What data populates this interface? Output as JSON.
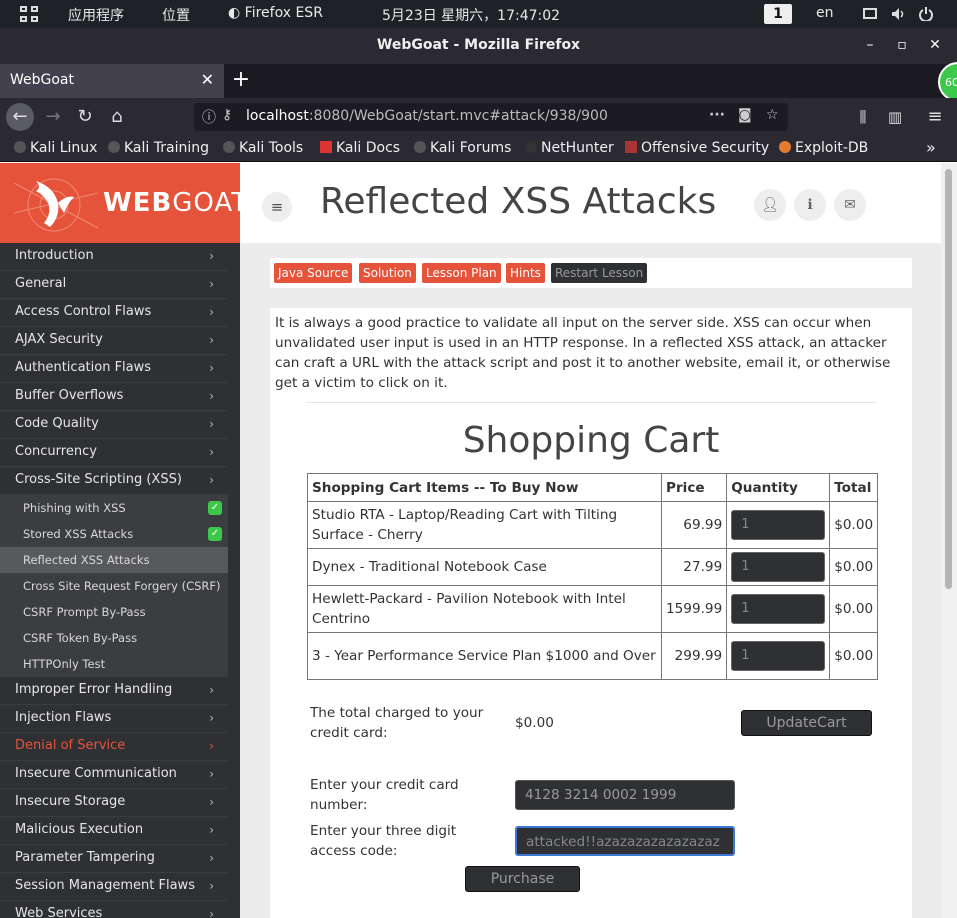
{
  "os": {
    "apps_label": "应用程序",
    "places_label": "位置",
    "active_app": "Firefox ESR",
    "clock": "5月23日 星期六，17:47:02",
    "workspace": "1",
    "lang": "en"
  },
  "window": {
    "title": "WebGoat - Mozilla Firefox"
  },
  "tab": {
    "label": "WebGoat",
    "badge": "60"
  },
  "url": {
    "host": "localhost",
    "rest": ":8080/WebGoat/start.mvc#attack/938/900"
  },
  "bookmarks": [
    "Kali Linux",
    "Kali Training",
    "Kali Tools",
    "Kali Docs",
    "Kali Forums",
    "NetHunter",
    "Offensive Security",
    "Exploit-DB"
  ],
  "logo": {
    "bold": "WEB",
    "light": "GOAT"
  },
  "menu": {
    "introduction": "Introduction",
    "general": "General",
    "access_control": "Access Control Flaws",
    "ajax": "AJAX Security",
    "authentication": "Authentication Flaws",
    "buffer": "Buffer Overflows",
    "code_quality": "Code Quality",
    "concurrency": "Concurrency",
    "xss": "Cross-Site Scripting (XSS)",
    "sub_phishing": "Phishing with XSS",
    "sub_stored": "Stored XSS Attacks",
    "sub_reflected": "Reflected XSS Attacks",
    "sub_csrf": "Cross Site Request Forgery (CSRF)",
    "sub_csrf_prompt": "CSRF Prompt By-Pass",
    "sub_csrf_token": "CSRF Token By-Pass",
    "sub_httponly": "HTTPOnly Test",
    "error_handling": "Improper Error Handling",
    "injection": "Injection Flaws",
    "dos": "Denial of Service",
    "insecure_comm": "Insecure Communication",
    "insecure_storage": "Insecure Storage",
    "malicious": "Malicious Execution",
    "param_tampering": "Parameter Tampering",
    "session": "Session Management Flaws",
    "web_services": "Web Services"
  },
  "header": {
    "title": "Reflected XSS Attacks"
  },
  "lesson_buttons": {
    "java_source": "Java Source",
    "solution": "Solution",
    "lesson_plan": "Lesson Plan",
    "hints": "Hints",
    "restart": "Restart Lesson"
  },
  "intro": "It is always a good practice to validate all input on the server side. XSS can occur when unvalidated user input is used in an HTTP response. In a reflected XSS attack, an attacker can craft a URL with the attack script and post it to another website, email it, or otherwise get a victim to click on it.",
  "cart": {
    "title": "Shopping Cart",
    "headers": [
      "Shopping Cart Items -- To Buy Now",
      "Price",
      "Quantity",
      "Total"
    ],
    "rows": [
      {
        "item": "Studio RTA - Laptop/Reading Cart with Tilting Surface - Cherry",
        "price": "69.99",
        "qty": "1",
        "total": "$0.00"
      },
      {
        "item": "Dynex - Traditional Notebook Case",
        "price": "27.99",
        "qty": "1",
        "total": "$0.00"
      },
      {
        "item": "Hewlett-Packard - Pavilion Notebook with Intel Centrino",
        "price": "1599.99",
        "qty": "1",
        "total": "$0.00"
      },
      {
        "item": "3 - Year Performance Service Plan $1000 and Over",
        "price": "299.99",
        "qty": "1",
        "total": "$0.00"
      }
    ]
  },
  "form": {
    "total_label": "The total charged to your credit card:",
    "total_value": "$0.00",
    "update_button": "UpdateCart",
    "card_label": "Enter your credit card number:",
    "card_value": "4128 3214 0002 1999",
    "code_label": "Enter your three digit access code:",
    "code_value": "attacked!!azazazazazazazaz",
    "purchase_button": "Purchase"
  }
}
